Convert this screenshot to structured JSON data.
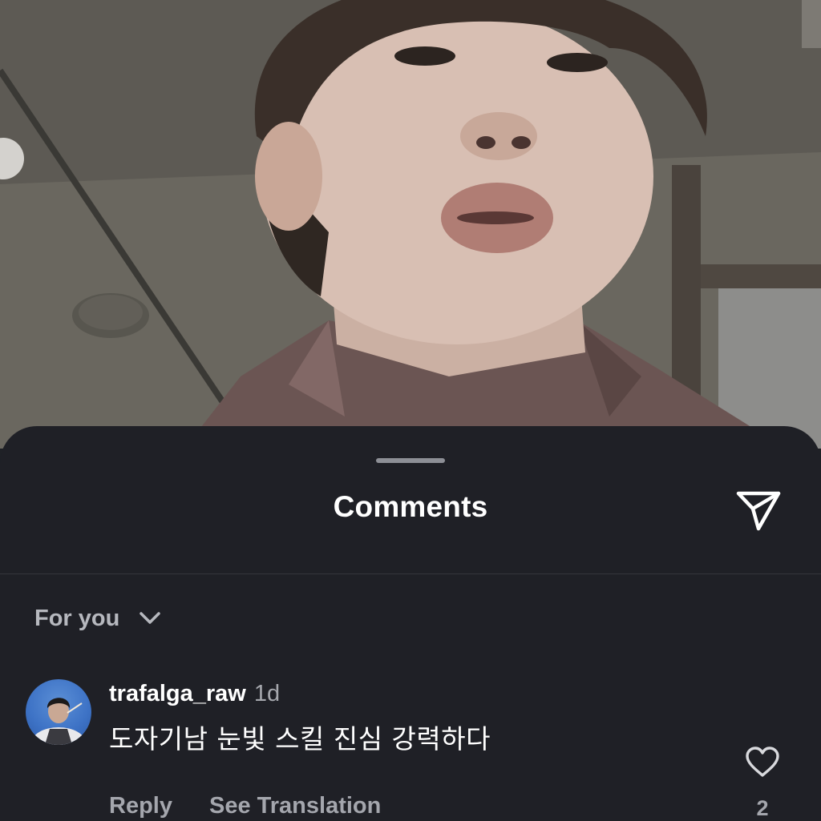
{
  "background_photo": {
    "description_icon": "person-photo"
  },
  "sheet": {
    "title": "Comments",
    "share_icon": "send-icon",
    "filter": {
      "label": "For you",
      "icon": "chevron-down-icon"
    }
  },
  "comments": [
    {
      "username": "trafalga_raw",
      "time": "1d",
      "text": "도자기남 눈빛 스킬 진심 강력하다",
      "reply_label": "Reply",
      "translate_label": "See Translation",
      "like_icon": "heart-icon",
      "likes": "2"
    }
  ],
  "colors": {
    "sheet_bg": "#1f2026",
    "primary_text": "#ffffff",
    "secondary_text": "#a4a6ad"
  }
}
